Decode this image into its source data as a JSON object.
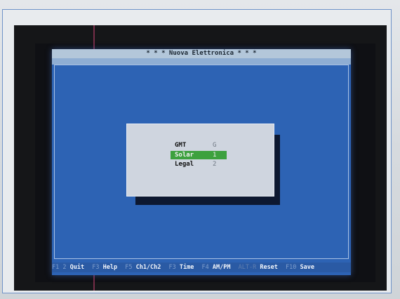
{
  "screen": {
    "title": "* * *  Nuova  Elettronica  * * *"
  },
  "dialog": {
    "options": [
      {
        "label": "GMT",
        "key": "G",
        "selected": false
      },
      {
        "label": "Solar",
        "key": "1",
        "selected": true
      },
      {
        "label": "Legal",
        "key": "2",
        "selected": false
      }
    ]
  },
  "status_bar": {
    "items": [
      {
        "key": "F1 2",
        "label": "Quit"
      },
      {
        "key": "F3",
        "label": "Help"
      },
      {
        "key": "F5",
        "label": "Ch1/Ch2"
      },
      {
        "key": "F3",
        "label": "Time"
      },
      {
        "key": "F4",
        "label": "AM/PM"
      },
      {
        "key": "ALT-R",
        "label": "Reset"
      },
      {
        "key": "F10",
        "label": "Save"
      }
    ]
  },
  "colors": {
    "screen_blue": "#2d63b4",
    "title_bar": "#b3c7da",
    "dialog_bg": "#cfd5df",
    "selected_green": "#3da13e",
    "frame_blue": "#6f93c8"
  }
}
